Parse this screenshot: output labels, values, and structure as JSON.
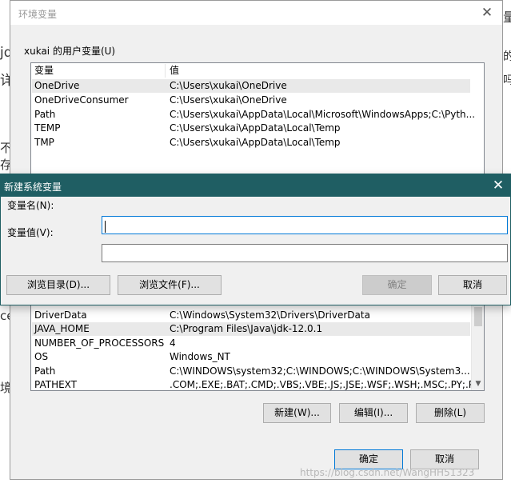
{
  "background_fragments": [
    "jd",
    "详",
    "不存",
    "ce",
    "境",
    "量",
    "的",
    "吗"
  ],
  "env_dialog": {
    "title": "环境变量",
    "close_glyph": "✕",
    "user_group_label": "xukai 的用户变量(U)",
    "columns": {
      "name": "变量",
      "value": "值"
    },
    "user_vars": [
      {
        "name": "OneDrive",
        "value": "C:\\Users\\xukai\\OneDrive"
      },
      {
        "name": "OneDriveConsumer",
        "value": "C:\\Users\\xukai\\OneDrive"
      },
      {
        "name": "Path",
        "value": "C:\\Users\\xukai\\AppData\\Local\\Microsoft\\WindowsApps;C:\\Pyth..."
      },
      {
        "name": "TEMP",
        "value": "C:\\Users\\xukai\\AppData\\Local\\Temp"
      },
      {
        "name": "TMP",
        "value": "C:\\Users\\xukai\\AppData\\Local\\Temp"
      }
    ],
    "system_vars": [
      {
        "name": "DriverData",
        "value": "C:\\Windows\\System32\\Drivers\\DriverData"
      },
      {
        "name": "JAVA_HOME",
        "value": "C:\\Program Files\\Java\\jdk-12.0.1"
      },
      {
        "name": "NUMBER_OF_PROCESSORS",
        "value": "4"
      },
      {
        "name": "OS",
        "value": "Windows_NT"
      },
      {
        "name": "Path",
        "value": "C:\\WINDOWS\\system32;C:\\WINDOWS;C:\\WINDOWS\\System3..."
      },
      {
        "name": "PATHEXT",
        "value": ".COM;.EXE;.BAT;.CMD;.VBS;.VBE;.JS;.JSE;.WSF;.WSH;.MSC;.PY;.PY..."
      }
    ],
    "system_buttons": {
      "new": "新建(W)...",
      "edit": "编辑(I)...",
      "delete": "删除(L)"
    },
    "ok_label": "确定",
    "cancel_label": "取消",
    "scroll_up_glyph": "▲",
    "scroll_down_glyph": "▼"
  },
  "new_dialog": {
    "title": "新建系统变量",
    "close_glyph": "✕",
    "name_label": "变量名(N):",
    "value_label": "变量值(V):",
    "name_value": "",
    "value_value": "",
    "browse_dir_label": "浏览目录(D)...",
    "browse_file_label": "浏览文件(F)...",
    "ok_label": "确定",
    "cancel_label": "取消"
  },
  "watermark": "https://blog.csdn.net/WangHH51323",
  "colors": {
    "title_accent": "#1f5e63",
    "focus_border": "#0078d7"
  }
}
